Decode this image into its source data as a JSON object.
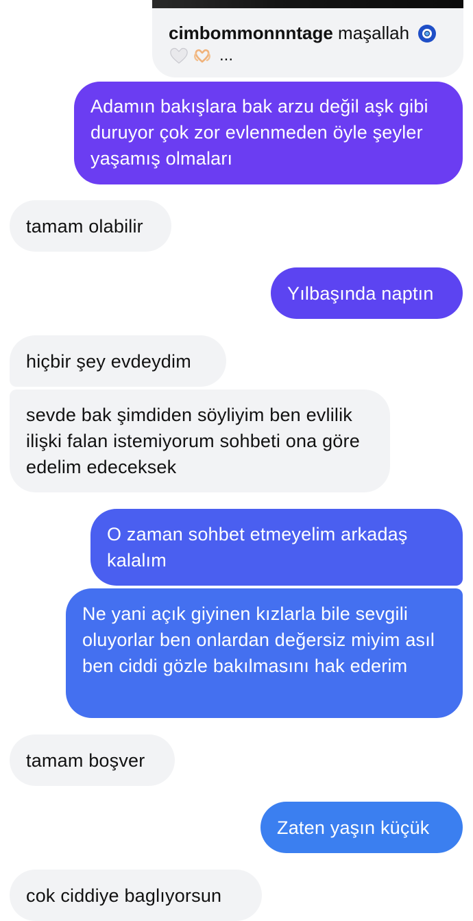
{
  "shared_post": {
    "username": "cimbommonnntage",
    "caption": "maşallah",
    "icons": [
      "evil-eye-icon",
      "white-heart-icon",
      "heart-hands-icon"
    ],
    "more": "..."
  },
  "messages": [
    {
      "side": "out",
      "text": "Adamın bakışlara bak arzu değil aşk gibi duruyor çok zor evlenmeden öyle şeyler yaşamış olmaları"
    },
    {
      "side": "in",
      "text": "tamam olabilir"
    },
    {
      "side": "out",
      "text": "Yılbaşında naptın"
    },
    {
      "side": "in",
      "text": "hiçbir şey evdeydim"
    },
    {
      "side": "in",
      "text": "sevde bak şimdiden söyliyim ben evlilik ilişki falan istemiyorum sohbeti ona göre edelim edeceksek"
    },
    {
      "side": "out",
      "text": "O zaman sohbet etmeyelim arkadaş kalalım"
    },
    {
      "side": "out",
      "text": "Ne yani açık giyinen kızlarla bile sevgili oluyorlar ben onlardan değersiz miyim asıl ben ciddi gözle bakılmasını hak ederim"
    },
    {
      "side": "in",
      "text": "tamam boşver"
    },
    {
      "side": "out",
      "text": "Zaten yaşın küçük"
    },
    {
      "side": "in",
      "text": "cok ciddiye baglıyorsun"
    }
  ],
  "colors": {
    "incoming_bubble": "#f2f3f5",
    "outgoing_gradient_top": "#6b3df2",
    "outgoing_gradient_bottom": "#3b82f0"
  }
}
